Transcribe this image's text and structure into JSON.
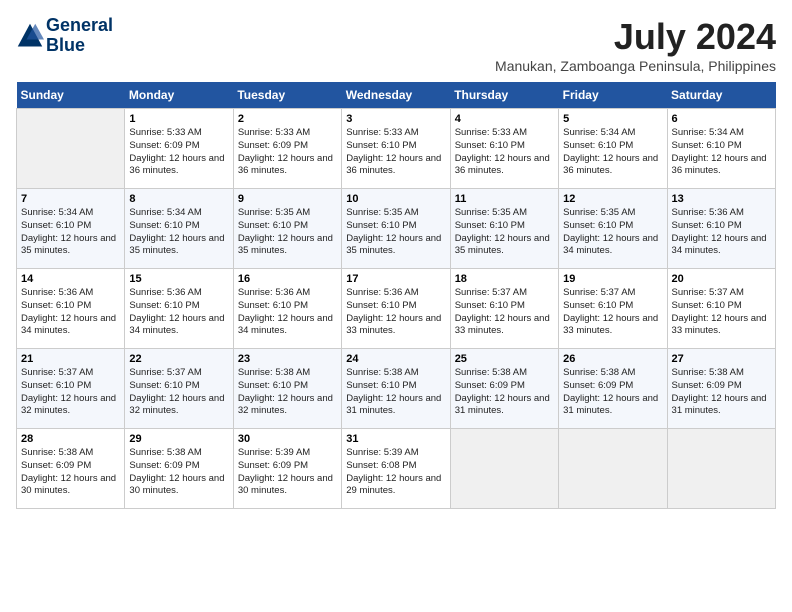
{
  "logo": {
    "line1": "General",
    "line2": "Blue"
  },
  "title": "July 2024",
  "location": "Manukan, Zamboanga Peninsula, Philippines",
  "weekdays": [
    "Sunday",
    "Monday",
    "Tuesday",
    "Wednesday",
    "Thursday",
    "Friday",
    "Saturday"
  ],
  "weeks": [
    [
      {
        "day": "",
        "empty": true
      },
      {
        "day": "1",
        "sunrise": "5:33 AM",
        "sunset": "6:09 PM",
        "daylight": "12 hours and 36 minutes."
      },
      {
        "day": "2",
        "sunrise": "5:33 AM",
        "sunset": "6:09 PM",
        "daylight": "12 hours and 36 minutes."
      },
      {
        "day": "3",
        "sunrise": "5:33 AM",
        "sunset": "6:10 PM",
        "daylight": "12 hours and 36 minutes."
      },
      {
        "day": "4",
        "sunrise": "5:33 AM",
        "sunset": "6:10 PM",
        "daylight": "12 hours and 36 minutes."
      },
      {
        "day": "5",
        "sunrise": "5:34 AM",
        "sunset": "6:10 PM",
        "daylight": "12 hours and 36 minutes."
      },
      {
        "day": "6",
        "sunrise": "5:34 AM",
        "sunset": "6:10 PM",
        "daylight": "12 hours and 36 minutes."
      }
    ],
    [
      {
        "day": "7",
        "sunrise": "5:34 AM",
        "sunset": "6:10 PM",
        "daylight": "12 hours and 35 minutes."
      },
      {
        "day": "8",
        "sunrise": "5:34 AM",
        "sunset": "6:10 PM",
        "daylight": "12 hours and 35 minutes."
      },
      {
        "day": "9",
        "sunrise": "5:35 AM",
        "sunset": "6:10 PM",
        "daylight": "12 hours and 35 minutes."
      },
      {
        "day": "10",
        "sunrise": "5:35 AM",
        "sunset": "6:10 PM",
        "daylight": "12 hours and 35 minutes."
      },
      {
        "day": "11",
        "sunrise": "5:35 AM",
        "sunset": "6:10 PM",
        "daylight": "12 hours and 35 minutes."
      },
      {
        "day": "12",
        "sunrise": "5:35 AM",
        "sunset": "6:10 PM",
        "daylight": "12 hours and 34 minutes."
      },
      {
        "day": "13",
        "sunrise": "5:36 AM",
        "sunset": "6:10 PM",
        "daylight": "12 hours and 34 minutes."
      }
    ],
    [
      {
        "day": "14",
        "sunrise": "5:36 AM",
        "sunset": "6:10 PM",
        "daylight": "12 hours and 34 minutes."
      },
      {
        "day": "15",
        "sunrise": "5:36 AM",
        "sunset": "6:10 PM",
        "daylight": "12 hours and 34 minutes."
      },
      {
        "day": "16",
        "sunrise": "5:36 AM",
        "sunset": "6:10 PM",
        "daylight": "12 hours and 34 minutes."
      },
      {
        "day": "17",
        "sunrise": "5:36 AM",
        "sunset": "6:10 PM",
        "daylight": "12 hours and 33 minutes."
      },
      {
        "day": "18",
        "sunrise": "5:37 AM",
        "sunset": "6:10 PM",
        "daylight": "12 hours and 33 minutes."
      },
      {
        "day": "19",
        "sunrise": "5:37 AM",
        "sunset": "6:10 PM",
        "daylight": "12 hours and 33 minutes."
      },
      {
        "day": "20",
        "sunrise": "5:37 AM",
        "sunset": "6:10 PM",
        "daylight": "12 hours and 33 minutes."
      }
    ],
    [
      {
        "day": "21",
        "sunrise": "5:37 AM",
        "sunset": "6:10 PM",
        "daylight": "12 hours and 32 minutes."
      },
      {
        "day": "22",
        "sunrise": "5:37 AM",
        "sunset": "6:10 PM",
        "daylight": "12 hours and 32 minutes."
      },
      {
        "day": "23",
        "sunrise": "5:38 AM",
        "sunset": "6:10 PM",
        "daylight": "12 hours and 32 minutes."
      },
      {
        "day": "24",
        "sunrise": "5:38 AM",
        "sunset": "6:10 PM",
        "daylight": "12 hours and 31 minutes."
      },
      {
        "day": "25",
        "sunrise": "5:38 AM",
        "sunset": "6:09 PM",
        "daylight": "12 hours and 31 minutes."
      },
      {
        "day": "26",
        "sunrise": "5:38 AM",
        "sunset": "6:09 PM",
        "daylight": "12 hours and 31 minutes."
      },
      {
        "day": "27",
        "sunrise": "5:38 AM",
        "sunset": "6:09 PM",
        "daylight": "12 hours and 31 minutes."
      }
    ],
    [
      {
        "day": "28",
        "sunrise": "5:38 AM",
        "sunset": "6:09 PM",
        "daylight": "12 hours and 30 minutes."
      },
      {
        "day": "29",
        "sunrise": "5:38 AM",
        "sunset": "6:09 PM",
        "daylight": "12 hours and 30 minutes."
      },
      {
        "day": "30",
        "sunrise": "5:39 AM",
        "sunset": "6:09 PM",
        "daylight": "12 hours and 30 minutes."
      },
      {
        "day": "31",
        "sunrise": "5:39 AM",
        "sunset": "6:08 PM",
        "daylight": "12 hours and 29 minutes."
      },
      {
        "day": "",
        "empty": true
      },
      {
        "day": "",
        "empty": true
      },
      {
        "day": "",
        "empty": true
      }
    ]
  ]
}
